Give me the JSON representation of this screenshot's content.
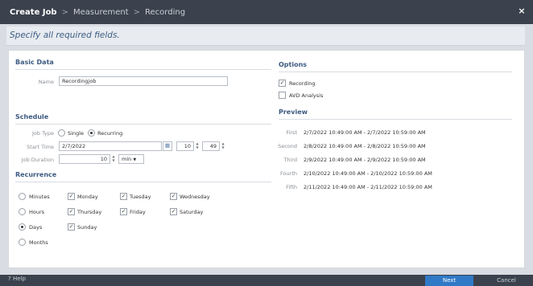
{
  "window": {
    "crumb1": "Create Job",
    "sep1": ">",
    "crumb2": "Measurement",
    "sep2": ">",
    "crumb3": "Recording",
    "close": "×"
  },
  "subtitle": "Specify all required fields.",
  "basic_data": {
    "heading": "Basic Data",
    "name_label": "Name",
    "name_value": "Recordingjob"
  },
  "schedule": {
    "heading": "Schedule",
    "job_type_label": "Job Type",
    "single_label": "Single",
    "recurring_label": "Recurring",
    "job_type_selected": "Recurring",
    "start_time_label": "Start Time",
    "start_date": "2/7/2022",
    "start_hour": "10",
    "start_minute": "49",
    "duration_label": "Job Duration",
    "duration_value": "10",
    "duration_unit": "min"
  },
  "recurrence": {
    "heading": "Recurrence",
    "periods": [
      "Minutes",
      "Hours",
      "Days",
      "Months"
    ],
    "selected_period": "Days",
    "days": [
      {
        "label": "Monday",
        "checked": true
      },
      {
        "label": "Tuesday",
        "checked": true
      },
      {
        "label": "Wednesday",
        "checked": true
      },
      {
        "label": "Thursday",
        "checked": true
      },
      {
        "label": "Friday",
        "checked": true
      },
      {
        "label": "Saturday",
        "checked": true
      },
      {
        "label": "Sunday",
        "checked": true
      }
    ]
  },
  "options": {
    "heading": "Options",
    "recording_label": "Recording",
    "recording_checked": true,
    "avd_label": "AVD Analysis",
    "avd_checked": false
  },
  "preview": {
    "heading": "Preview",
    "rows": [
      {
        "label": "First",
        "value": "2/7/2022 10:49:00 AM - 2/7/2022 10:59:00 AM"
      },
      {
        "label": "Second",
        "value": "2/8/2022 10:49:00 AM - 2/8/2022 10:59:00 AM"
      },
      {
        "label": "Third",
        "value": "2/9/2022 10:49:00 AM - 2/9/2022 10:59:00 AM"
      },
      {
        "label": "Fourth",
        "value": "2/10/2022 10:49:00 AM - 2/10/2022 10:59:00 AM"
      },
      {
        "label": "Fifth",
        "value": "2/11/2022 10:49:00 AM - 2/11/2022 10:59:00 AM"
      }
    ]
  },
  "footer": {
    "help_label": "Help",
    "help_icon": "?",
    "next_label": "Next",
    "cancel_label": "Cancel"
  }
}
